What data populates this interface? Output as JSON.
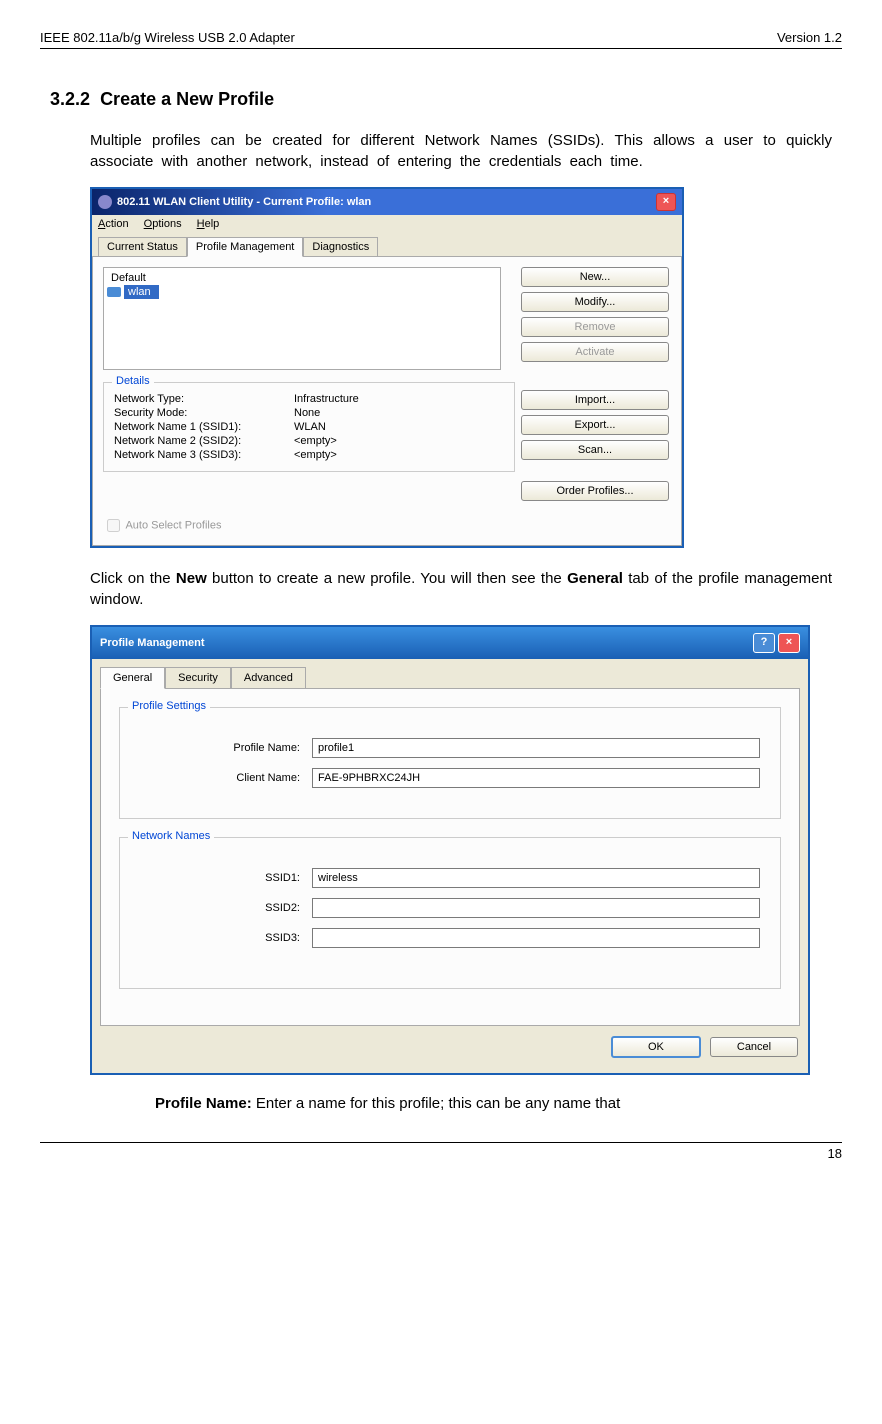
{
  "header": {
    "left": "IEEE 802.11a/b/g Wireless USB 2.0 Adapter",
    "right": "Version 1.2"
  },
  "section": {
    "number": "3.2.2",
    "title": "Create a New Profile"
  },
  "para1": "Multiple profiles can be created for different Network Names (SSIDs). This allows a user to quickly associate with another network, instead of entering the credentials each time.",
  "para2_a": "Click on the ",
  "para2_b": "New",
  "para2_c": " button to create a new profile.  You will then see the ",
  "para2_d": "General",
  "para2_e": " tab of the profile management window.",
  "win1": {
    "title": "802.11 WLAN Client Utility - Current Profile: wlan",
    "menu": {
      "action": "Action",
      "options": "Options",
      "help": "Help"
    },
    "tabs": {
      "status": "Current Status",
      "profile": "Profile Management",
      "diag": "Diagnostics"
    },
    "profiles": {
      "default": "Default",
      "wlan": "wlan"
    },
    "buttons": {
      "new": "New...",
      "modify": "Modify...",
      "remove": "Remove",
      "activate": "Activate",
      "import": "Import...",
      "export": "Export...",
      "scan": "Scan...",
      "order": "Order Profiles..."
    },
    "details": {
      "legend": "Details",
      "rows": [
        {
          "label": "Network Type:",
          "value": "Infrastructure"
        },
        {
          "label": "Security Mode:",
          "value": "None"
        },
        {
          "label": "Network Name 1 (SSID1):",
          "value": "WLAN"
        },
        {
          "label": "Network Name 2 (SSID2):",
          "value": "<empty>"
        },
        {
          "label": "Network Name 3 (SSID3):",
          "value": "<empty>"
        }
      ],
      "auto": "Auto Select Profiles"
    }
  },
  "win2": {
    "title": "Profile Management",
    "tabs": {
      "general": "General",
      "security": "Security",
      "advanced": "Advanced"
    },
    "profile_settings": {
      "legend": "Profile Settings",
      "profile_name_label": "Profile Name:",
      "profile_name_value": "profile1",
      "client_name_label": "Client Name:",
      "client_name_value": "FAE-9PHBRXC24JH"
    },
    "network_names": {
      "legend": "Network Names",
      "ssid1_label": "SSID1:",
      "ssid1_value": "wireless",
      "ssid2_label": "SSID2:",
      "ssid2_value": "",
      "ssid3_label": "SSID3:",
      "ssid3_value": ""
    },
    "buttons": {
      "ok": "OK",
      "cancel": "Cancel"
    }
  },
  "list_item": {
    "label": "Profile Name:",
    "text": " Enter a name for this profile; this can be any name that"
  },
  "footer": {
    "page": "18"
  }
}
